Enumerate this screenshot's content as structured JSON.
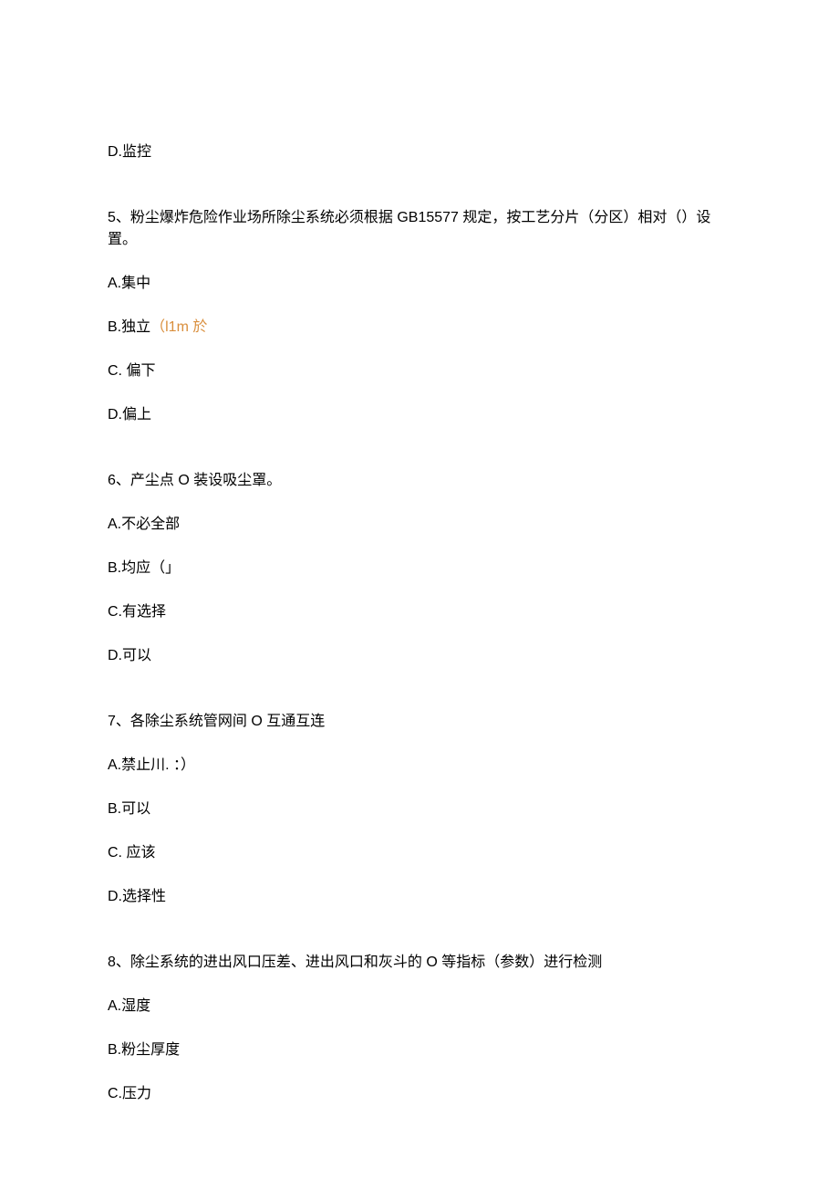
{
  "q4": {
    "optD": "D.监控"
  },
  "q5": {
    "stem": "5、粉尘爆炸危险作业场所除尘系统必须根据 GB15577 规定，按工艺分片（分区）相对（）设置。",
    "optA": "A.集中",
    "optB_prefix": "B.独立",
    "optB_note": "（l1m 於",
    "optC": "C. 偏下",
    "optD": "D.偏上"
  },
  "q6": {
    "stem": "6、产尘点 O 装设吸尘罩。",
    "optA": "A.不必全部",
    "optB": "B.均应（」",
    "optC": "C.有选择",
    "optD": "D.可以"
  },
  "q7": {
    "stem": "7、各除尘系统管网间 O 互通互连",
    "optA": "A.禁止川. ：）",
    "optB": "B.可以",
    "optC": "C. 应该",
    "optD": "D.选择性"
  },
  "q8": {
    "stem": "8、除尘系统的进出风口压差、进出风口和灰斗的 O 等指标（参数）进行检测",
    "optA": "A.湿度",
    "optB": "B.粉尘厚度",
    "optC": "C.压力"
  }
}
